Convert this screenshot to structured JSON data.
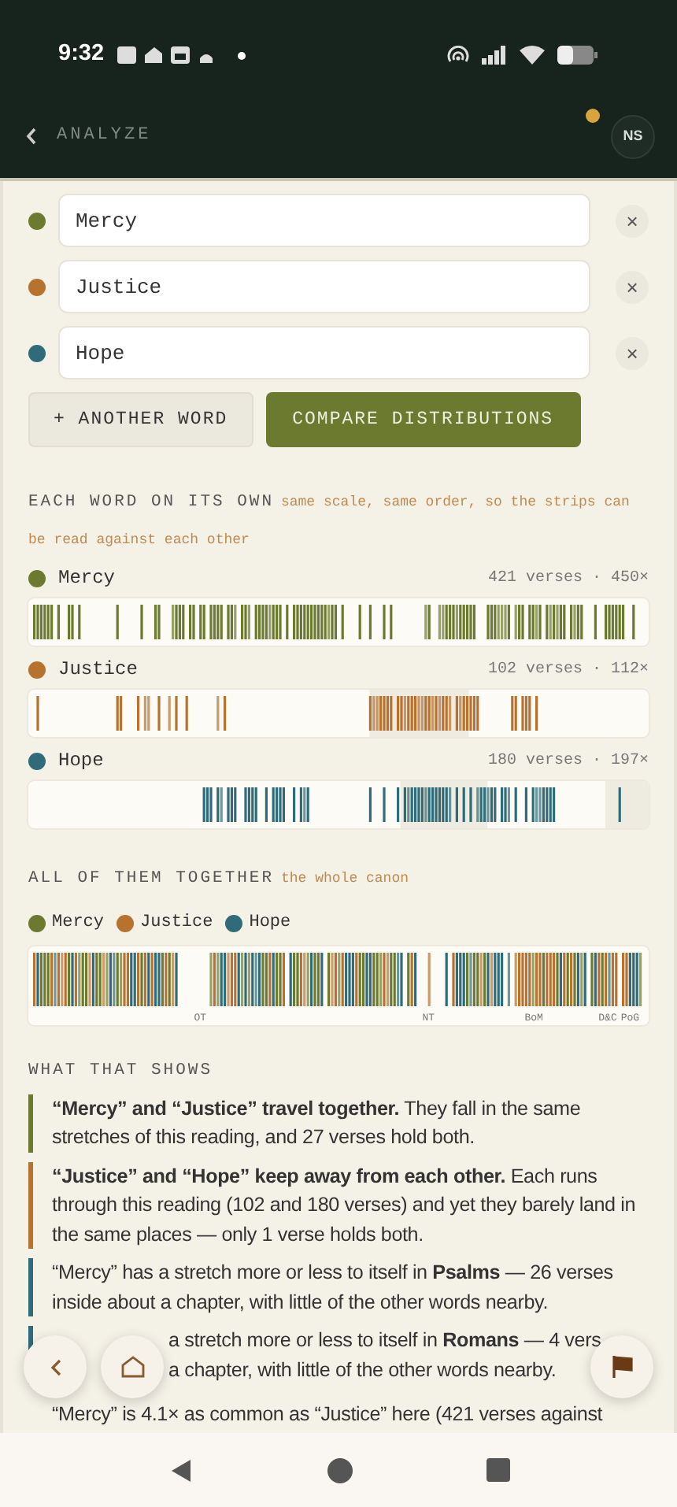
{
  "status_bar": {
    "time": "9:32"
  },
  "header": {
    "title": "ANALYZE",
    "avatar": "NS",
    "has_notification": true
  },
  "words": [
    {
      "value": "Mercy",
      "color": "#6b7a2e",
      "remove": "×"
    },
    {
      "value": "Justice",
      "color": "#b8722f",
      "remove": "×"
    },
    {
      "value": "Hope",
      "color": "#2f6b78",
      "remove": "×"
    }
  ],
  "actions": {
    "add": "+ ANOTHER WORD",
    "compare": "COMPARE DISTRIBUTIONS"
  },
  "individual": {
    "heading": "EACH WORD ON ITS OWN",
    "note": "same scale, same order, so the strips can be read against each other",
    "rows": [
      {
        "word": "Mercy",
        "color": "#6b7a2e",
        "stats": "421 verses · 450×"
      },
      {
        "word": "Justice",
        "color": "#b8722f",
        "stats": "102 verses · 112×"
      },
      {
        "word": "Hope",
        "color": "#2f6b78",
        "stats": "180 verses · 197×"
      }
    ]
  },
  "combined": {
    "heading": "ALL OF THEM TOGETHER",
    "note": "the whole canon",
    "legend": [
      {
        "label": "Mercy",
        "color": "#6b7a2e"
      },
      {
        "label": "Justice",
        "color": "#b8722f"
      },
      {
        "label": "Hope",
        "color": "#2f6b78"
      }
    ],
    "ticks": [
      "OT",
      "NT",
      "BoM",
      "D&C",
      "PoG"
    ]
  },
  "findings": {
    "heading": "WHAT THAT SHOWS",
    "items": [
      {
        "kind": "plain",
        "text": "**“Mercy” and “Justice” travel together.** They fall in the same stretches of this reading, and 27 verses hold both.",
        "color": "#6b7a2e"
      },
      {
        "kind": "plain",
        "text": "**“Justice” and “Hope” keep away from each other.** Each runs through this reading (102 and 180 verses) and yet they barely land in the same places — only 1 verse holds both.",
        "color": "#b8722f"
      },
      {
        "kind": "plain",
        "text": "“Mercy” has a stretch more or less to itself in **Psalms** — 26 verses inside about a chapter, with little of the other words nearby.",
        "color": "#2f6b78"
      },
      {
        "kind": "covered",
        "text": "a stretch more or less to itself in **Romans** — 4 vers\na chapter, with little of the other words nearby.",
        "color": "#2f6b78"
      },
      {
        "kind": "plain",
        "text": "“Mercy” is 4.1× as common as “Justice” here (421 verses against"
      }
    ]
  }
}
